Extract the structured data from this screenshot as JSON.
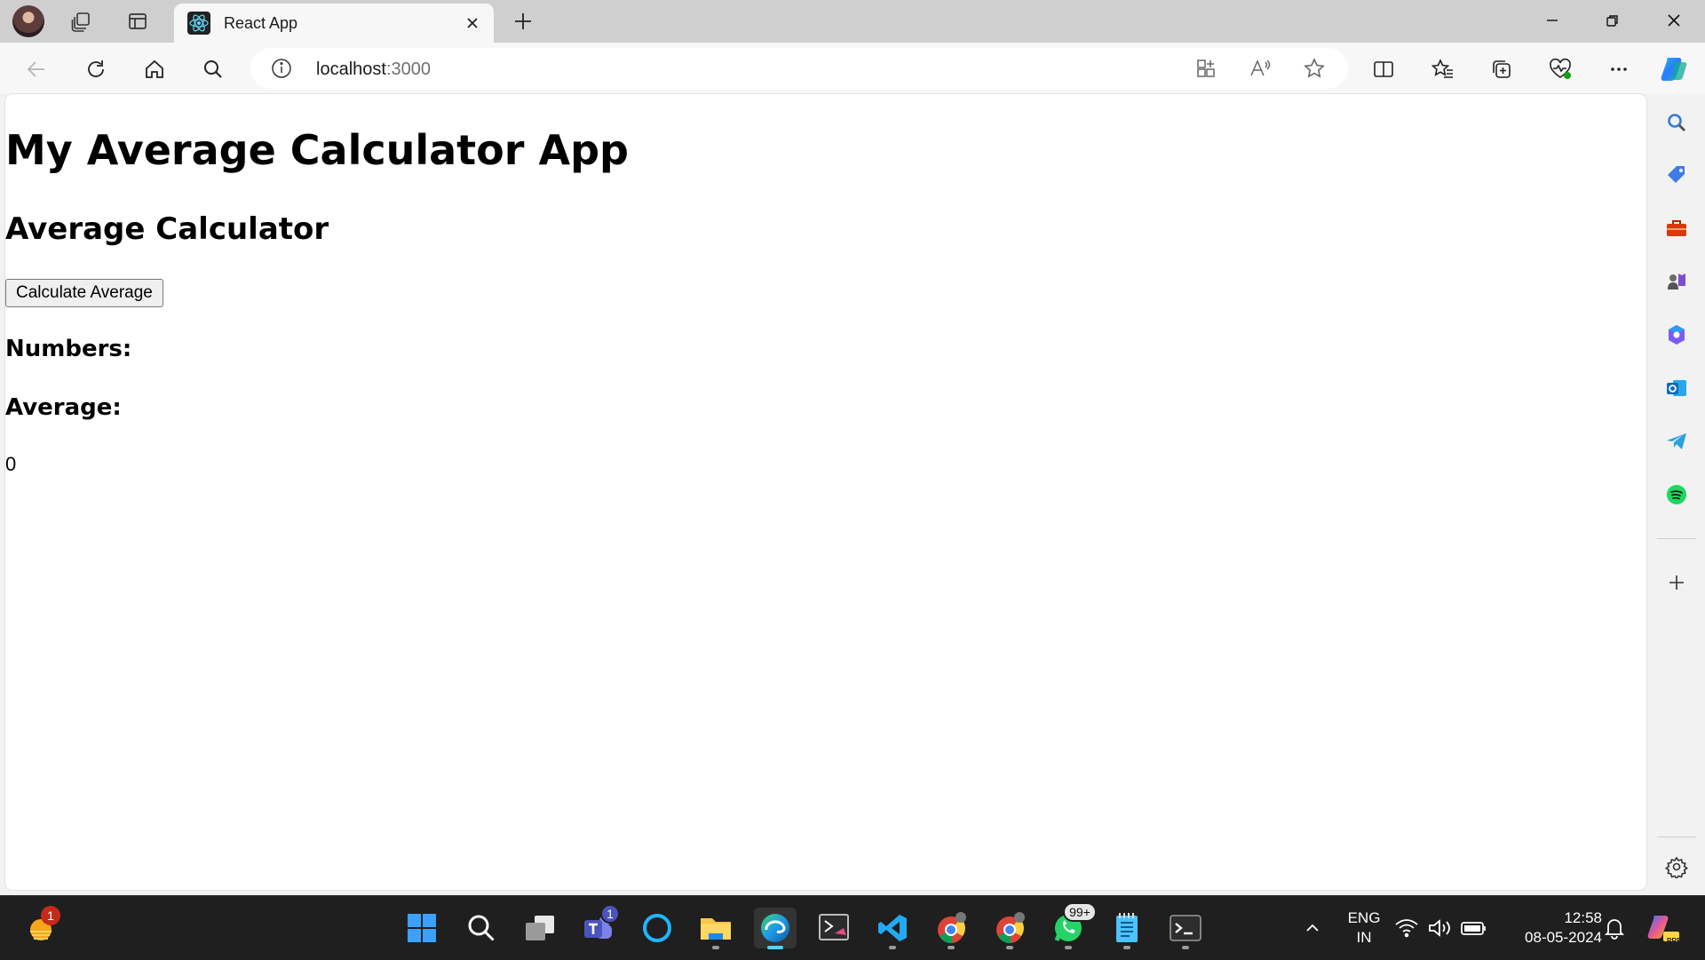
{
  "browser": {
    "tab": {
      "title": "React App"
    },
    "address": {
      "host": "localhost",
      "port": ":3000"
    }
  },
  "page": {
    "app_title": "My Average Calculator App",
    "section_title": "Average Calculator",
    "calculate_button": "Calculate Average",
    "numbers_label": "Numbers:",
    "average_label": "Average:",
    "average_value": "0"
  },
  "taskbar": {
    "weather_badge": "1",
    "teams_badge": "1",
    "whatsapp_badge": "99+",
    "language": "ENG",
    "region": "IN",
    "time": "12:58",
    "date": "08-05-2024",
    "copilot_tag": "PRE"
  },
  "colors": {
    "accent": "#0078d4",
    "tab_strip": "#cfcfcf",
    "taskbar": "#1f1f1f",
    "badge_red": "#c42b1c"
  }
}
